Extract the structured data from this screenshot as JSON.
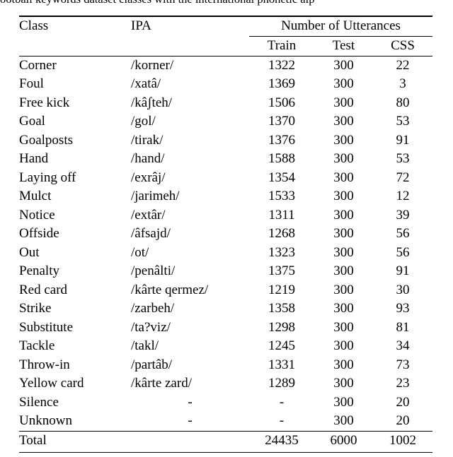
{
  "caption": {
    "clipped_text": "ootball keywords dataset classes with the international phonetic alp"
  },
  "table": {
    "group_header": "Number of Utterances",
    "headers": {
      "class": "Class",
      "ipa": "IPA",
      "train": "Train",
      "test": "Test",
      "css": "CSS"
    },
    "rows": [
      {
        "class": "Corner",
        "ipa": "/korner/",
        "train": "1322",
        "test": "300",
        "css": "22"
      },
      {
        "class": "Foul",
        "ipa": "/xatâ/",
        "train": "1369",
        "test": "300",
        "css": "3"
      },
      {
        "class": "Free kick",
        "ipa": "/kâʃteh/",
        "train": "1506",
        "test": "300",
        "css": "80"
      },
      {
        "class": "Goal",
        "ipa": "/gol/",
        "train": "1370",
        "test": "300",
        "css": "53"
      },
      {
        "class": "Goalposts",
        "ipa": "/tirak/",
        "train": "1376",
        "test": "300",
        "css": "91"
      },
      {
        "class": "Hand",
        "ipa": "/hand/",
        "train": "1588",
        "test": "300",
        "css": "53"
      },
      {
        "class": "Laying off",
        "ipa": "/exrâj/",
        "train": "1354",
        "test": "300",
        "css": "72"
      },
      {
        "class": "Mulct",
        "ipa": "/jarimeh/",
        "train": "1533",
        "test": "300",
        "css": "12"
      },
      {
        "class": "Notice",
        "ipa": "/extâr/",
        "train": "1311",
        "test": "300",
        "css": "39"
      },
      {
        "class": "Offside",
        "ipa": "/âfsajd/",
        "train": "1268",
        "test": "300",
        "css": "56"
      },
      {
        "class": "Out",
        "ipa": "/ot/",
        "train": "1323",
        "test": "300",
        "css": "56"
      },
      {
        "class": "Penalty",
        "ipa": "/penâlti/",
        "train": "1375",
        "test": "300",
        "css": "91"
      },
      {
        "class": "Red card",
        "ipa": "/kârte qermez/",
        "train": "1219",
        "test": "300",
        "css": "30"
      },
      {
        "class": "Strike",
        "ipa": "/zarbeh/",
        "train": "1358",
        "test": "300",
        "css": "93"
      },
      {
        "class": "Substitute",
        "ipa": "/ta?viz/",
        "train": "1298",
        "test": "300",
        "css": "81"
      },
      {
        "class": "Tackle",
        "ipa": "/takl/",
        "train": "1245",
        "test": "300",
        "css": "34"
      },
      {
        "class": "Throw-in",
        "ipa": "/partâb/",
        "train": "1331",
        "test": "300",
        "css": "73"
      },
      {
        "class": "Yellow card",
        "ipa": "/kârte zard/",
        "train": "1289",
        "test": "300",
        "css": "23"
      },
      {
        "class": "Silence",
        "ipa": "-",
        "train": "-",
        "test": "300",
        "css": "20"
      },
      {
        "class": "Unknown",
        "ipa": "-",
        "train": "-",
        "test": "300",
        "css": "20"
      }
    ],
    "total": {
      "label": "Total",
      "ipa": "",
      "train": "24435",
      "test": "6000",
      "css": "1002"
    }
  }
}
